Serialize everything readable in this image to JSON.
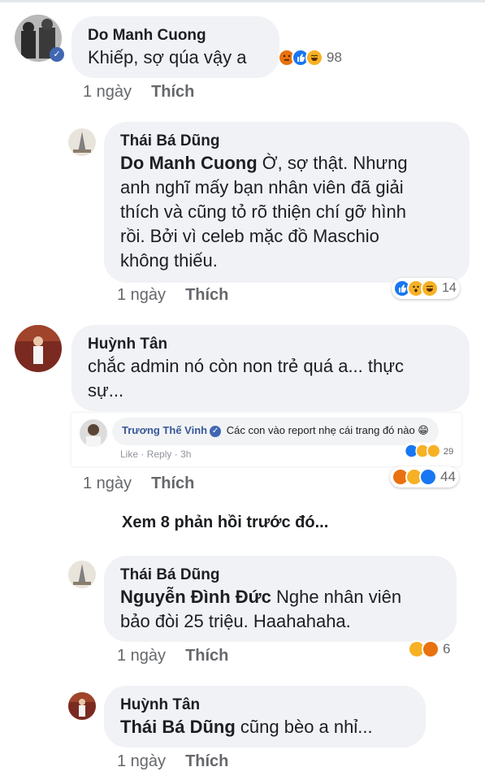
{
  "ui": {
    "like_label": "Thích",
    "time_label": "1 ngày"
  },
  "comments": [
    {
      "author": "Do Manh Cuong",
      "text": "Khiếp, sợ qúa vậy a",
      "reaction_count": "98"
    },
    {
      "author": "Thái Bá Dũng",
      "mention": "Do Manh Cuong",
      "lines": [
        "Ờ, sợ thật. Nhưng",
        "anh nghĩ mấy bạn nhân viên đã giải",
        "thích và cũng tỏ rõ thiện chí gỡ hình",
        "rồi. Bởi vì celeb mặc đồ Maschio",
        "không thiếu."
      ],
      "reaction_count": "14"
    },
    {
      "author": "Huỳnh Tân",
      "lines": [
        "chắc admin nó còn non trẻ quá a... thực",
        "sự..."
      ],
      "reaction_count": "44"
    },
    {
      "author": "Thái Bá Dũng",
      "mention": "Nguyễn Đình Đức",
      "lines": [
        "Nghe nhân viên",
        "bảo đòi 25 triệu. Haahahaha."
      ],
      "reaction_count": "6"
    },
    {
      "author": "Huỳnh Tân",
      "mention": "Thái Bá Dũng",
      "lines": [
        "cũng bèo a nhỉ..."
      ]
    }
  ],
  "embedded": {
    "author": "Trương Thế Vinh",
    "text": "Các con vào report nhẹ cái trang đó nào 😁",
    "like": "Like",
    "sep": "·",
    "reply": "Reply",
    "time": "3h",
    "reaction_count": "29"
  },
  "more_replies": "Xem 8 phản hồi trước đó...",
  "colors": {
    "bubble": "#f0f2f5",
    "meta": "#65676b",
    "like_blue": "#1877f2",
    "angry": "#e9710f",
    "haha": "#f7b125",
    "link": "#385898"
  }
}
